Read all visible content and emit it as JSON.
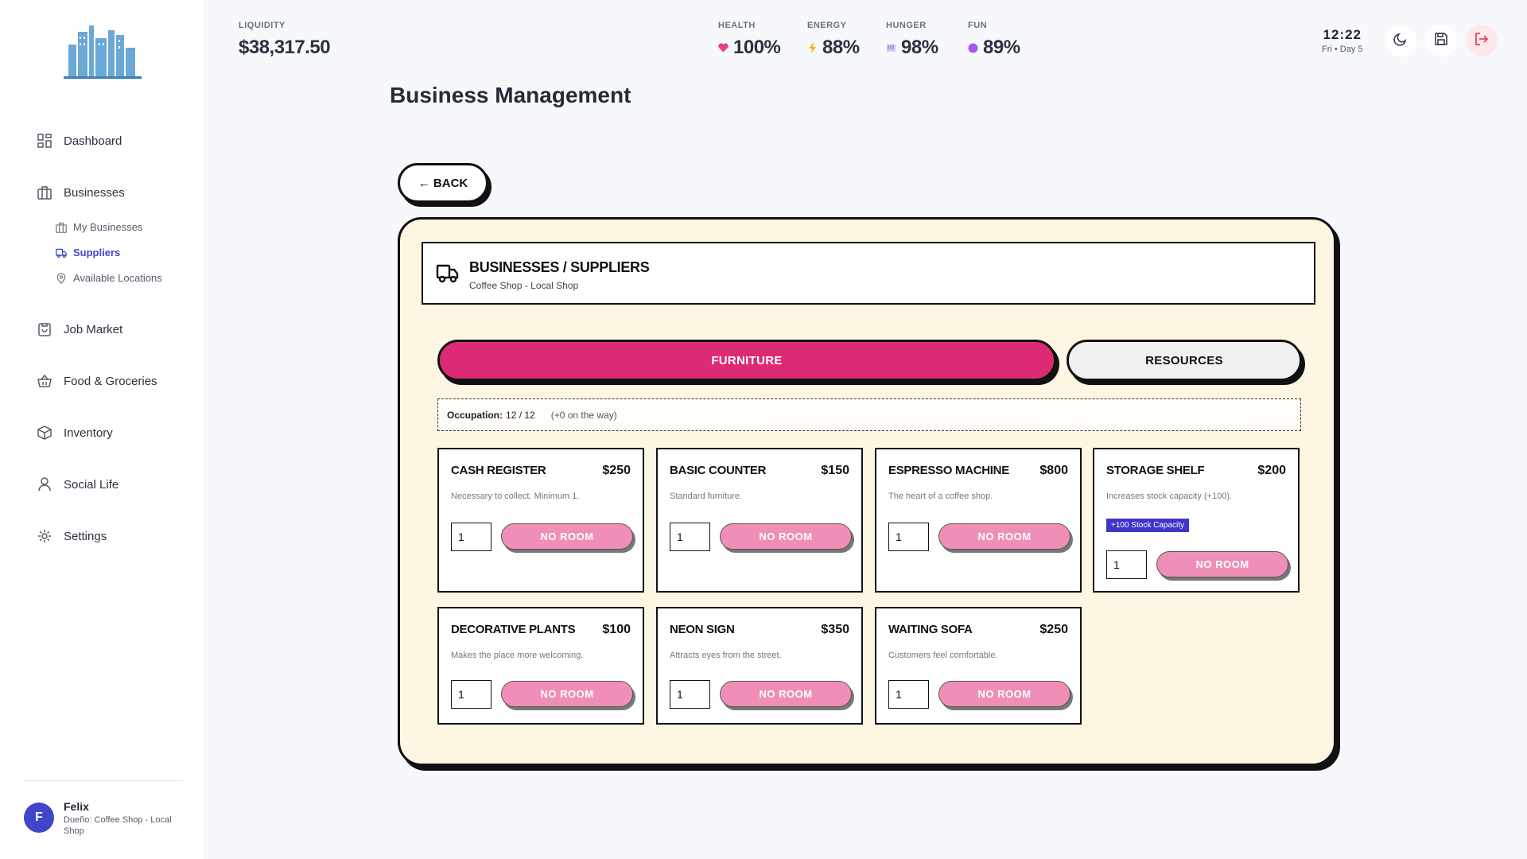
{
  "sidebar": {
    "nav": [
      {
        "label": "Dashboard",
        "icon": "dashboard-icon"
      },
      {
        "label": "Businesses",
        "icon": "briefcase-icon"
      },
      {
        "label": "Job Market",
        "icon": "clipboard-icon"
      },
      {
        "label": "Food & Groceries",
        "icon": "basket-icon"
      },
      {
        "label": "Inventory",
        "icon": "box-icon"
      },
      {
        "label": "Social Life",
        "icon": "person-icon"
      },
      {
        "label": "Settings",
        "icon": "gear-icon"
      }
    ],
    "sub": [
      {
        "label": "My Businesses",
        "icon": "briefcase-icon"
      },
      {
        "label": "Suppliers",
        "icon": "truck-icon",
        "active": true
      },
      {
        "label": "Available Locations",
        "icon": "pin-icon"
      }
    ],
    "user": {
      "initial": "F",
      "name": "Felix",
      "role": "Dueño: Coffee Shop - Local Shop"
    }
  },
  "topbar": {
    "liquidity_label": "LIQUIDITY",
    "liquidity_value": "$38,317.50",
    "stats": [
      {
        "label": "HEALTH",
        "value": "100%",
        "icon": "heart-icon",
        "color": "#e83e8c"
      },
      {
        "label": "ENERGY",
        "value": "88%",
        "icon": "lightning-icon",
        "color": "#f5b700"
      },
      {
        "label": "HUNGER",
        "value": "98%",
        "icon": "food-icon",
        "color": "#b79ad9"
      },
      {
        "label": "FUN",
        "value": "89%",
        "icon": "circle-icon",
        "color": "#a855f7"
      }
    ],
    "time": "12:22",
    "day": "Fri • Day 5"
  },
  "page_title": "Business Management",
  "back_label": "← BACK",
  "panel": {
    "title": "BUSINESSES / SUPPLIERS",
    "subtitle": "Coffee Shop - Local Shop",
    "tabs": {
      "furniture": "FURNITURE",
      "resources": "RESOURCES"
    },
    "occupation_label": "Occupation:",
    "occupation_value": "12 / 12",
    "occupation_way": "(+0 on the way)"
  },
  "items": [
    {
      "name": "CASH REGISTER",
      "price": "$250",
      "desc": "Necessary to collect. Minimum 1.",
      "qty": "1",
      "button": "NO ROOM"
    },
    {
      "name": "BASIC COUNTER",
      "price": "$150",
      "desc": "Standard furniture.",
      "qty": "1",
      "button": "NO ROOM"
    },
    {
      "name": "ESPRESSO MACHINE",
      "price": "$800",
      "desc": "The heart of a coffee shop.",
      "qty": "1",
      "button": "NO ROOM"
    },
    {
      "name": "STORAGE SHELF",
      "price": "$200",
      "desc": "Increases stock capacity (+100).",
      "badge": "+100 Stock Capacity",
      "qty": "1",
      "button": "NO ROOM"
    },
    {
      "name": "DECORATIVE PLANTS",
      "price": "$100",
      "desc": "Makes the place more welcoming.",
      "qty": "1",
      "button": "NO ROOM"
    },
    {
      "name": "NEON SIGN",
      "price": "$350",
      "desc": "Attracts eyes from the street.",
      "qty": "1",
      "button": "NO ROOM"
    },
    {
      "name": "WAITING SOFA",
      "price": "$250",
      "desc": "Customers feel comfortable.",
      "qty": "1",
      "button": "NO ROOM"
    }
  ],
  "colors": {
    "accent": "#dc2a75",
    "active_nav": "#3f46c8",
    "panel_bg": "#fdf6e3",
    "no_room": "#ef8fb7"
  }
}
